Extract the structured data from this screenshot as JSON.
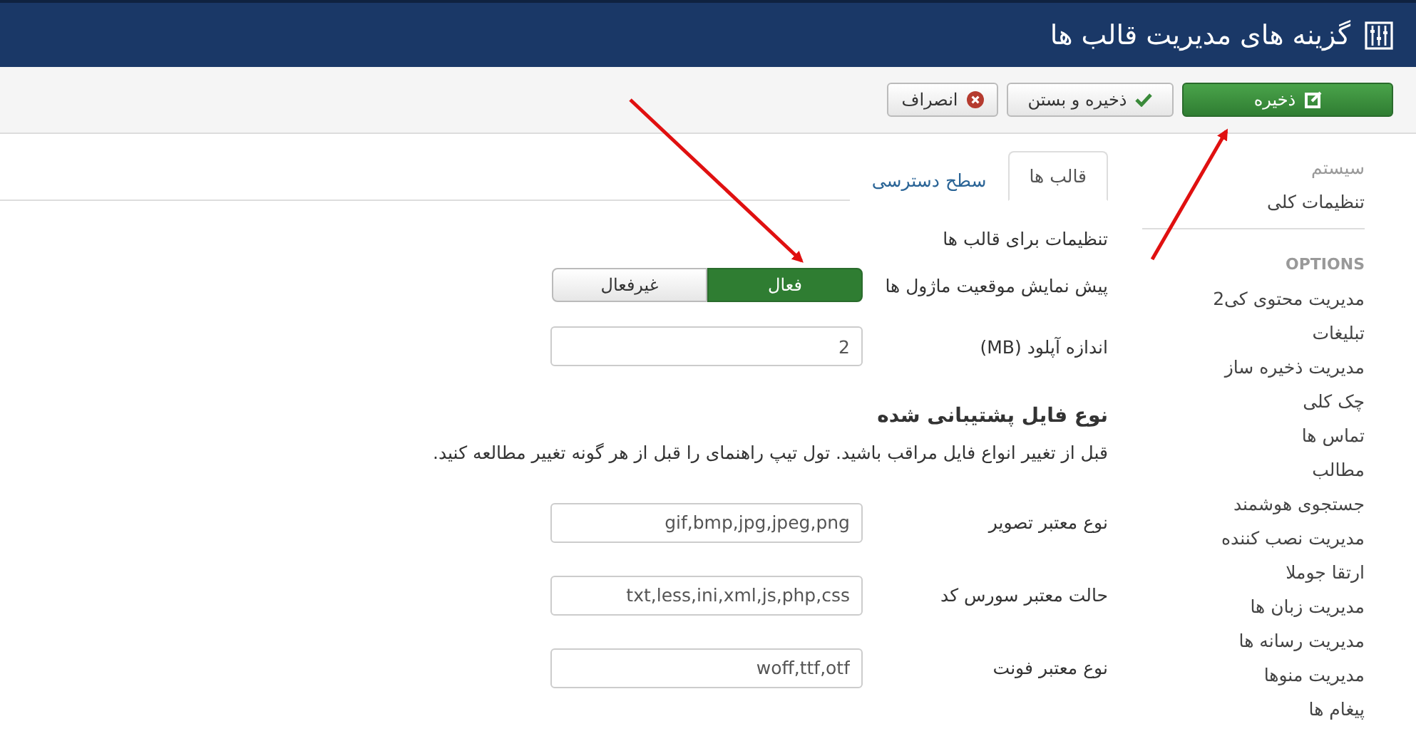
{
  "header": {
    "title": "گزینه های مدیریت قالب ها"
  },
  "toolbar": {
    "buttons": [
      {
        "label": "ذخیره",
        "kind": "save"
      },
      {
        "label": "ذخیره و بستن",
        "kind": "save-close"
      },
      {
        "label": "انصراف",
        "kind": "cancel"
      }
    ]
  },
  "sidebar": {
    "system": [
      {
        "label": "سیستم",
        "selected": true
      },
      {
        "label": "تنظیمات کلی",
        "selected": false
      }
    ],
    "options_heading": "OPTIONS",
    "options": [
      "مدیریت محتوی کی2",
      "تبلیغات",
      "مدیریت ذخیره ساز",
      "چک کلی",
      "تماس ها",
      "مطالب",
      "جستجوی هوشمند",
      "مدیریت نصب کننده",
      "ارتقا جوملا",
      "مدیریت زبان ها",
      "مدیریت رسانه ها",
      "مدیریت منوها",
      "پیغام ها"
    ]
  },
  "tabs": [
    {
      "label": "قالب ها",
      "selected": true
    },
    {
      "label": "سطح دسترسی",
      "selected": false
    }
  ],
  "form": {
    "intro": "تنظیمات برای قالب ها",
    "toggle": {
      "label": "پیش نمایش موقعیت ماژول ها",
      "options": [
        {
          "label": "فعال",
          "selected": true
        },
        {
          "label": "غیرفعال",
          "selected": false
        }
      ]
    },
    "upload": {
      "label": "اندازه آپلود (MB)",
      "value": "2"
    },
    "section_title": "نوع فایل پشتیبانی شده",
    "section_note": "قبل از تغییر انواع فایل مراقب باشید. تول تیپ راهنمای را قبل از هر گونه تغییر مطالعه کنید.",
    "fields": [
      {
        "label": "نوع معتبر تصویر",
        "value": "gif,bmp,jpg,jpeg,png"
      },
      {
        "label": "حالت معتبر سورس کد",
        "value": "txt,less,ini,xml,js,php,css"
      },
      {
        "label": "نوع معتبر فونت",
        "value": "woff,ttf,otf"
      }
    ]
  }
}
